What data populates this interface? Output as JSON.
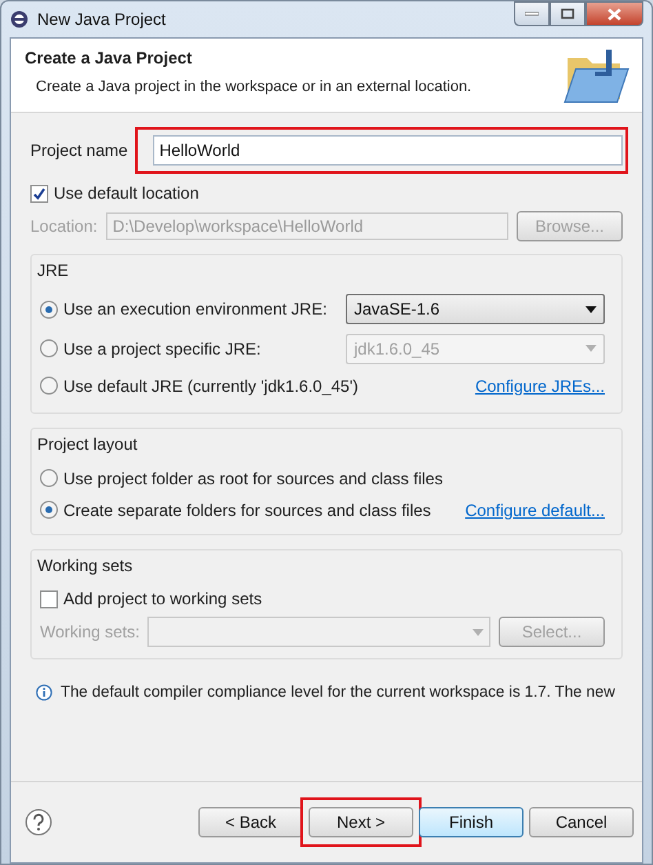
{
  "window": {
    "title": "New Java Project"
  },
  "header": {
    "title": "Create a Java Project",
    "description": "Create a Java project in the workspace or in an external location."
  },
  "project_name": {
    "label": "Project name",
    "value": "HelloWorld",
    "highlighted": true
  },
  "default_location": {
    "label": "Use default location",
    "checked": true
  },
  "location": {
    "label": "Location:",
    "value": "D:\\Develop\\workspace\\HelloWorld",
    "disabled": true,
    "button": "Browse..."
  },
  "jre": {
    "title": "JRE",
    "options": [
      {
        "label": "Use an execution environment JRE:",
        "selected": true,
        "kind": "dropdown",
        "value": "JavaSE-1.6",
        "disabled": false
      },
      {
        "label": "Use a project specific JRE:",
        "selected": false,
        "kind": "dropdown",
        "value": "jdk1.6.0_45",
        "disabled": true
      },
      {
        "label": "Use default JRE (currently 'jdk1.6.0_45')",
        "selected": false,
        "kind": "link",
        "link": "Configure JREs..."
      }
    ]
  },
  "project_layout": {
    "title": "Project layout",
    "options": [
      {
        "label": "Use project folder as root for sources and class files",
        "selected": false
      },
      {
        "label": "Create separate folders for sources and class files",
        "selected": true,
        "link": "Configure default..."
      }
    ]
  },
  "working_sets": {
    "title": "Working sets",
    "checkbox": {
      "label": "Add project to working sets",
      "checked": false
    },
    "field_label": "Working sets:",
    "button": "Select...",
    "disabled": true
  },
  "info": {
    "message": "The default compiler compliance level for the current workspace is 1.7. The new"
  },
  "buttons": [
    {
      "label": "< Back",
      "highlighted": false,
      "default": false
    },
    {
      "label": "Next >",
      "highlighted": true,
      "default": false
    },
    {
      "label": "Finish",
      "highlighted": false,
      "default": true
    },
    {
      "label": "Cancel",
      "highlighted": false,
      "default": false
    }
  ]
}
